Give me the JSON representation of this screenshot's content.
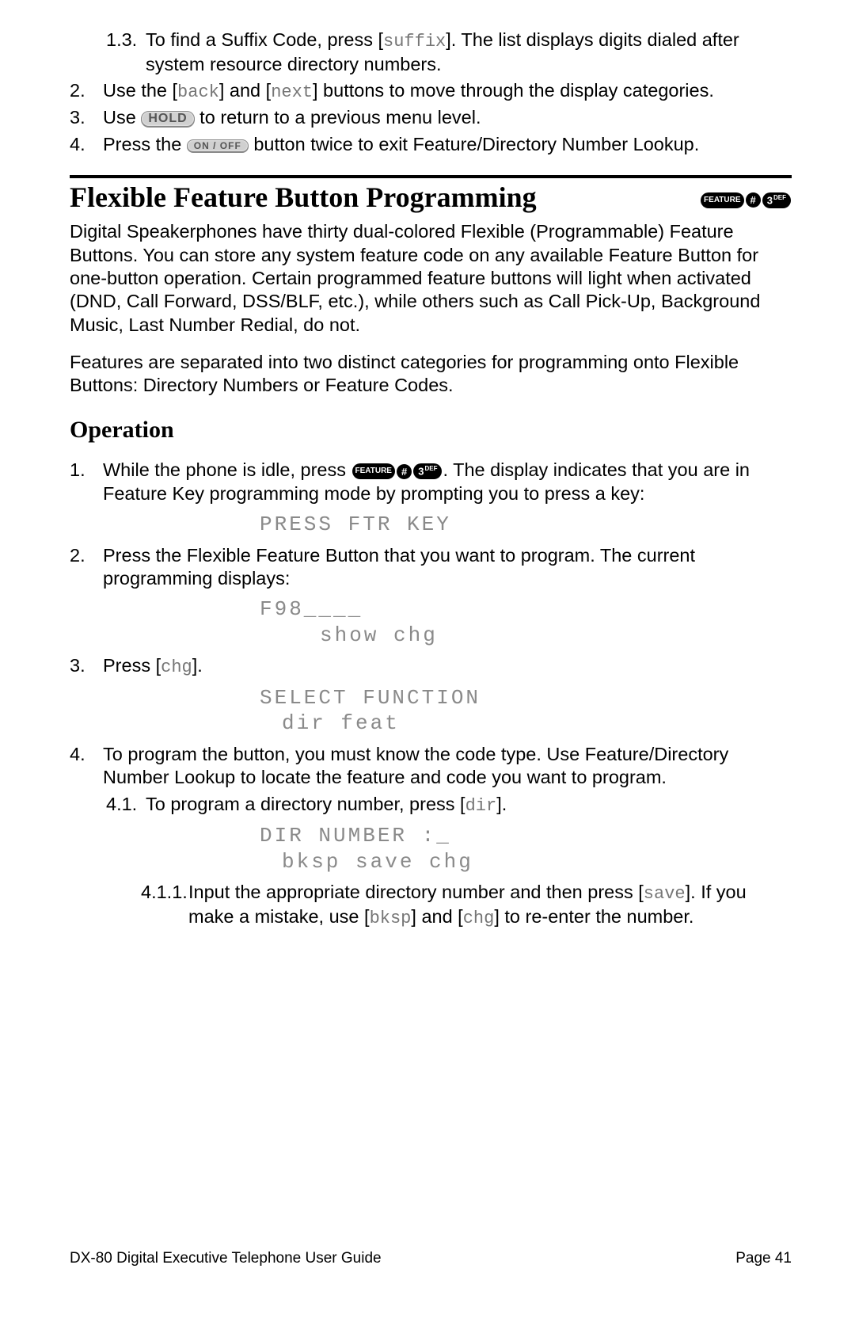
{
  "top": {
    "item1_3_num": "1.3.",
    "item1_3_txt_a": "To find a Suffix Code, press [",
    "item1_3_key": "suffix",
    "item1_3_txt_b": "]. The list displays digits dialed after system resource directory numbers.",
    "item2_num": "2.",
    "item2_txt_a": "Use the [",
    "item2_key1": "back",
    "item2_txt_b": "] and [",
    "item2_key2": "next",
    "item2_txt_c": "] buttons to move through the display categories.",
    "item3_num": "3.",
    "item3_txt_a": "Use ",
    "item3_btn": "HOLD",
    "item3_txt_b": " to return to a previous menu level.",
    "item4_num": "4.",
    "item4_txt_a": "Press the ",
    "item4_btn": "ON / OFF",
    "item4_txt_b": " button twice to exit Feature/Directory Number Lookup."
  },
  "section": {
    "title": "Flexible Feature Button Programming",
    "pills": {
      "feature": "FEATURE",
      "hash": "#",
      "three": "3",
      "def": "DEF"
    },
    "para1": "Digital Speakerphones have thirty dual-colored Flexible (Programmable) Feature Buttons. You can store any system feature code on any available Feature Button for one-button operation. Certain programmed feature buttons will light when activated (DND, Call Forward, DSS/BLF, etc.), while others such as Call Pick-Up, Background Music, Last Number Redial, do not.",
    "para2": "Features are separated into two distinct categories for programming onto Flexible Buttons: Directory Numbers or Feature Codes."
  },
  "operation": {
    "heading": "Operation",
    "s1_num": "1.",
    "s1_a": "While the phone is idle, press ",
    "s1_b": ". The display indicates that you are in Feature Key programming mode by prompting you to press a key:",
    "lcd1": "PRESS FTR KEY",
    "s2_num": "2.",
    "s2": "Press the Flexible Feature Button that you want to program. The current programming displays:",
    "lcd2a": "F98____",
    "lcd2b": "show chg",
    "s3_num": "3.",
    "s3_a": "Press [",
    "s3_key": "chg",
    "s3_b": "].",
    "lcd3a": "SELECT FUNCTION",
    "lcd3b": "dir feat",
    "s4_num": "4.",
    "s4": "To program the button, you must know the code type. Use Feature/Directory Number Lookup to locate the feature and code you want to program.",
    "s41_num": "4.1.",
    "s41_a": "To program a directory number, press [",
    "s41_key": "dir",
    "s41_b": "].",
    "lcd4a": "DIR NUMBER :_",
    "lcd4b": "bksp save chg",
    "s411_num": "4.1.1.",
    "s411_a": "Input the appropriate directory number and then press [",
    "s411_key1": "save",
    "s411_b": "]. If you make a mistake, use [",
    "s411_key2": "bksp",
    "s411_c": "] and [",
    "s411_key3": "chg",
    "s411_d": "] to re-enter the number."
  },
  "footer": {
    "left": "DX-80 Digital Executive Telephone User Guide",
    "right": "Page 41"
  }
}
